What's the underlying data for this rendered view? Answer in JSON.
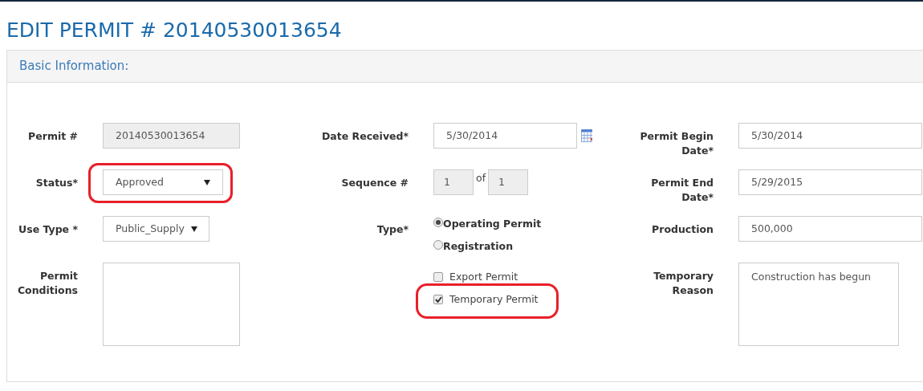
{
  "title": "EDIT PERMIT # 20140530013654",
  "panel": {
    "heading": "Basic Information:"
  },
  "columns": [
    {
      "fields": [
        {
          "kind": "readonly",
          "label": "Permit #",
          "value": "20140530013654"
        },
        {
          "kind": "select",
          "label": "Status*",
          "value": "Approved",
          "highlighted": true
        },
        {
          "kind": "select",
          "label": "Use Type *",
          "value": "Public_Supply",
          "highlighted": false
        },
        {
          "kind": "textarea",
          "label": "Permit Conditions"
        }
      ]
    },
    {
      "fields": [
        {
          "kind": "date",
          "label": "Date Received*",
          "value": "5/30/2014"
        },
        {
          "kind": "sequence",
          "label": "Sequence #",
          "value": "1",
          "joiner": "of",
          "total": "1"
        },
        {
          "kind": "radio",
          "label": "Type*",
          "options": [
            {
              "label": "Operating Permit",
              "selected": true
            },
            {
              "label": "Registration",
              "selected": false
            }
          ]
        },
        {
          "kind": "checkboxes",
          "options": [
            {
              "label": "Export Permit",
              "checked": false,
              "highlighted": false
            },
            {
              "label": "Temporary Permit",
              "checked": true,
              "highlighted": true
            }
          ]
        }
      ]
    },
    {
      "fields": [
        {
          "kind": "text",
          "label": "Permit Begin Date*",
          "value": "5/30/2014"
        },
        {
          "kind": "text",
          "label": "Permit End Date*",
          "value": "5/29/2015"
        },
        {
          "kind": "text",
          "label": "Production",
          "value": "500,000"
        },
        {
          "kind": "textarea",
          "label": "Temporary Reason",
          "value": "Construction has begun"
        }
      ]
    }
  ]
}
